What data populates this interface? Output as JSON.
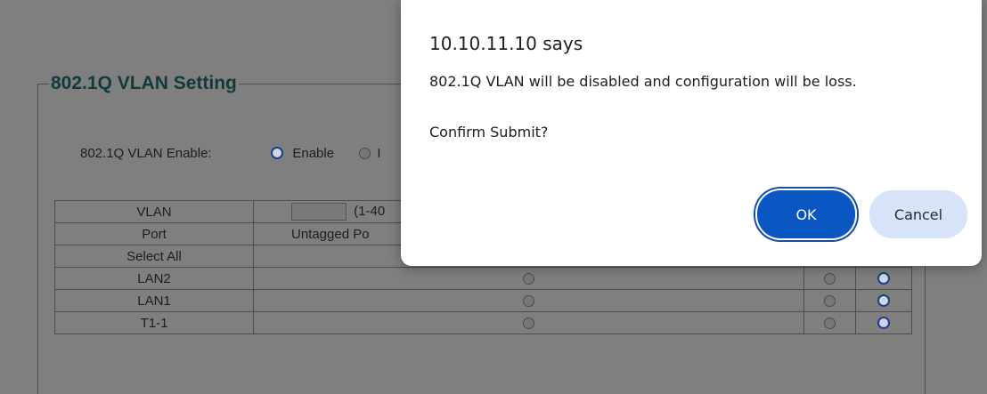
{
  "section_title": "802.1Q VLAN Setting",
  "enable_row": {
    "label": "802.1Q VLAN Enable:",
    "enable_label": "Enable",
    "disable_partial": "I"
  },
  "table": {
    "vlan_label": "VLAN",
    "vlan_range_hint": "(1-40",
    "port_label": "Port",
    "untagged_header_partial": "Untagged Po",
    "rows": [
      {
        "name": "Select All",
        "col1": "off",
        "col2": "off",
        "col3": "off"
      },
      {
        "name": "LAN2",
        "col1": "off",
        "col2": "off",
        "col3": "on"
      },
      {
        "name": "LAN1",
        "col1": "off",
        "col2": "off",
        "col3": "on"
      },
      {
        "name": "T1-1",
        "col1": "off",
        "col2": "off",
        "col3": "on"
      }
    ]
  },
  "dialog": {
    "title": "10.10.11.10 says",
    "message": "802.1Q VLAN will be disabled and configuration will be loss.",
    "question": "Confirm Submit?",
    "ok_label": "OK",
    "cancel_label": "Cancel"
  },
  "colors": {
    "overlay": "#7f7f7f",
    "ok_button": "#0a56c2",
    "cancel_button": "#d6e3f8",
    "radio_selected": "#0b3a92"
  }
}
